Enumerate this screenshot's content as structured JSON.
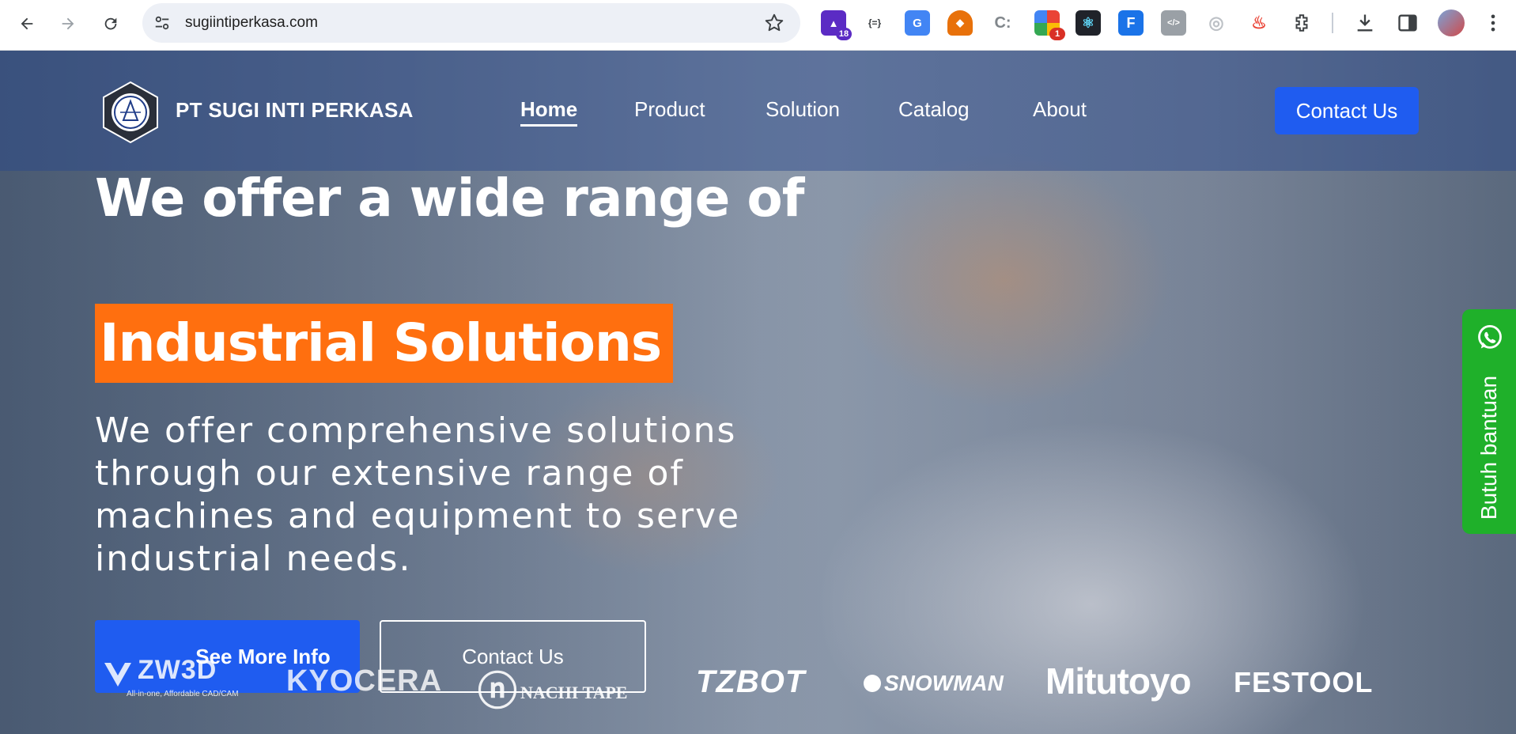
{
  "browser": {
    "url": "sugiintiperkasa.com",
    "extensions": [
      {
        "icon": "school-cap-icon",
        "badge": "18",
        "color": "#5b2bc4"
      },
      {
        "icon": "json-braces-icon",
        "label": "{=}",
        "color": "#3c4043"
      },
      {
        "icon": "google-translate-icon",
        "label": "G",
        "color": "#4285f4"
      },
      {
        "icon": "fox-icon",
        "color": "#e8710a"
      },
      {
        "icon": "c-logo-icon",
        "label": "C:",
        "color": "#80868b"
      },
      {
        "icon": "color-picker-icon",
        "badge": "1",
        "color": "#34a853"
      },
      {
        "icon": "react-icon",
        "color": "#20232a"
      },
      {
        "icon": "font-icon",
        "label": "F",
        "color": "#1a73e8"
      },
      {
        "icon": "code-tag-icon",
        "label": "</>",
        "color": "#9aa0a6"
      },
      {
        "icon": "spinner-icon",
        "color": "#bdc1c6"
      },
      {
        "icon": "fire-icon",
        "color": "#ea4335"
      },
      {
        "icon": "puzzle-icon",
        "color": "#3c4043"
      }
    ]
  },
  "header": {
    "brand": "PT SUGI INTI PERKASA",
    "nav": [
      {
        "label": "Home",
        "active": true
      },
      {
        "label": "Product",
        "active": false
      },
      {
        "label": "Solution",
        "active": false
      },
      {
        "label": "Catalog",
        "active": false
      },
      {
        "label": "About",
        "active": false
      }
    ],
    "contact_label": "Contact Us"
  },
  "hero": {
    "headline": "We offer a wide range of",
    "highlight": "Industrial Solutions",
    "highlight_color": "#ff6f0f",
    "description": "We offer comprehensive solutions through our extensive range of machines and equipment to serve industrial needs.",
    "primary_button": "See More Info",
    "secondary_button": "Contact Us",
    "accent_color": "#1f5cf0"
  },
  "partner_logos": {
    "zw3d": {
      "name": "ZW3D",
      "tagline": "All-in-one, Affordable CAD/CAM"
    },
    "kyocera": "KYOCERA",
    "nachi": "NACHI TAPE",
    "tzbot": "TZBOT",
    "snowman": "SNOWMAN",
    "mitutoyo": "Mitutoyo",
    "festool": "FESTOOL"
  },
  "whatsapp": {
    "label": "Butuh bantuan",
    "color": "#1fb02a"
  }
}
